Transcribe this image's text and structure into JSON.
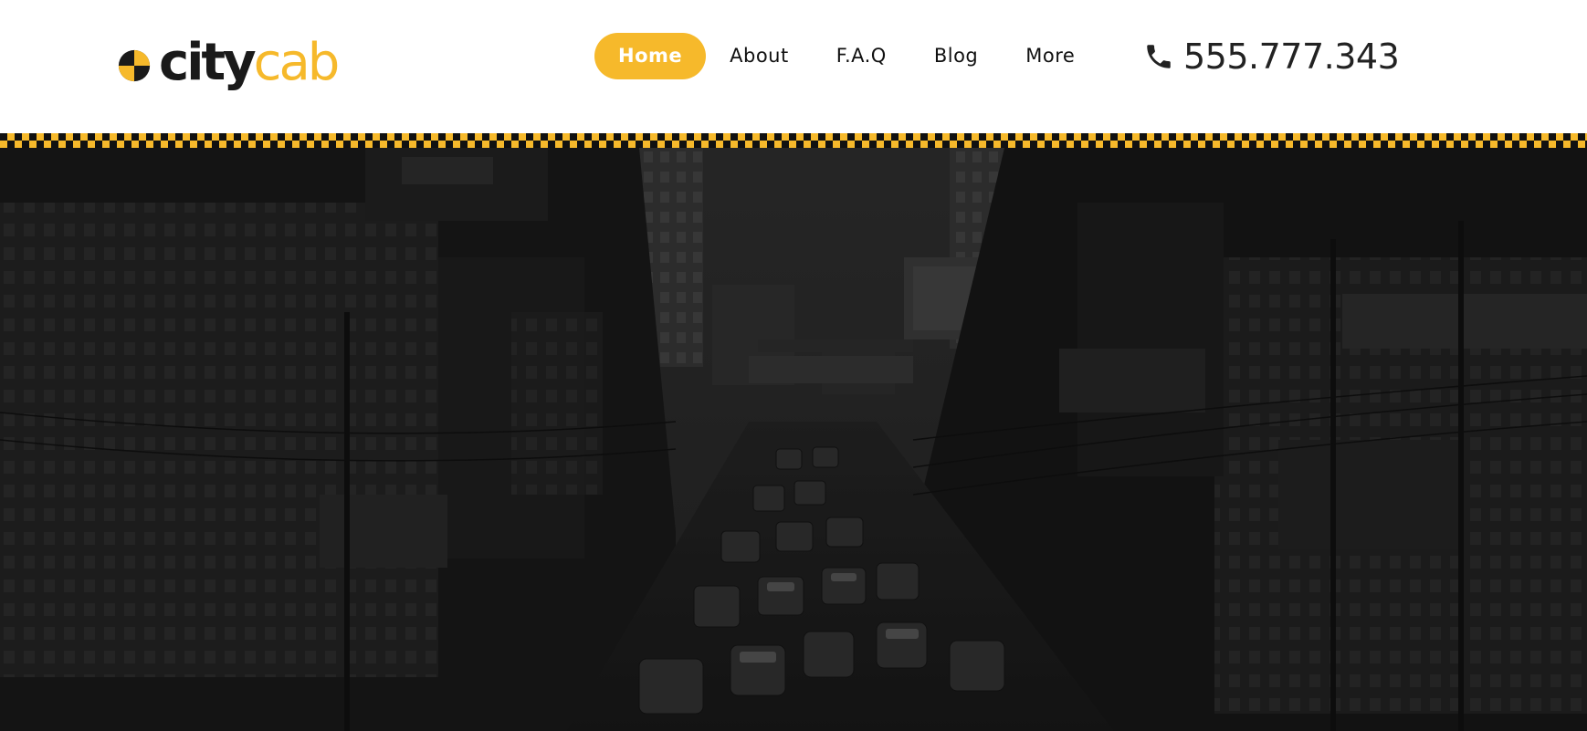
{
  "brand": {
    "name_part1": "city",
    "name_part2": "cab",
    "accent_color": "#f6b92b",
    "logo_icon": "taxi-checker-circle-icon"
  },
  "nav": {
    "items": [
      {
        "label": "Home",
        "active": true
      },
      {
        "label": "About",
        "active": false
      },
      {
        "label": "F.A.Q",
        "active": false
      },
      {
        "label": "Blog",
        "active": false
      },
      {
        "label": "More",
        "active": false
      }
    ]
  },
  "contact": {
    "phone_icon": "phone-icon",
    "phone": "555.777.343"
  },
  "hero": {
    "image": "dark-city-street-traffic-photo"
  }
}
